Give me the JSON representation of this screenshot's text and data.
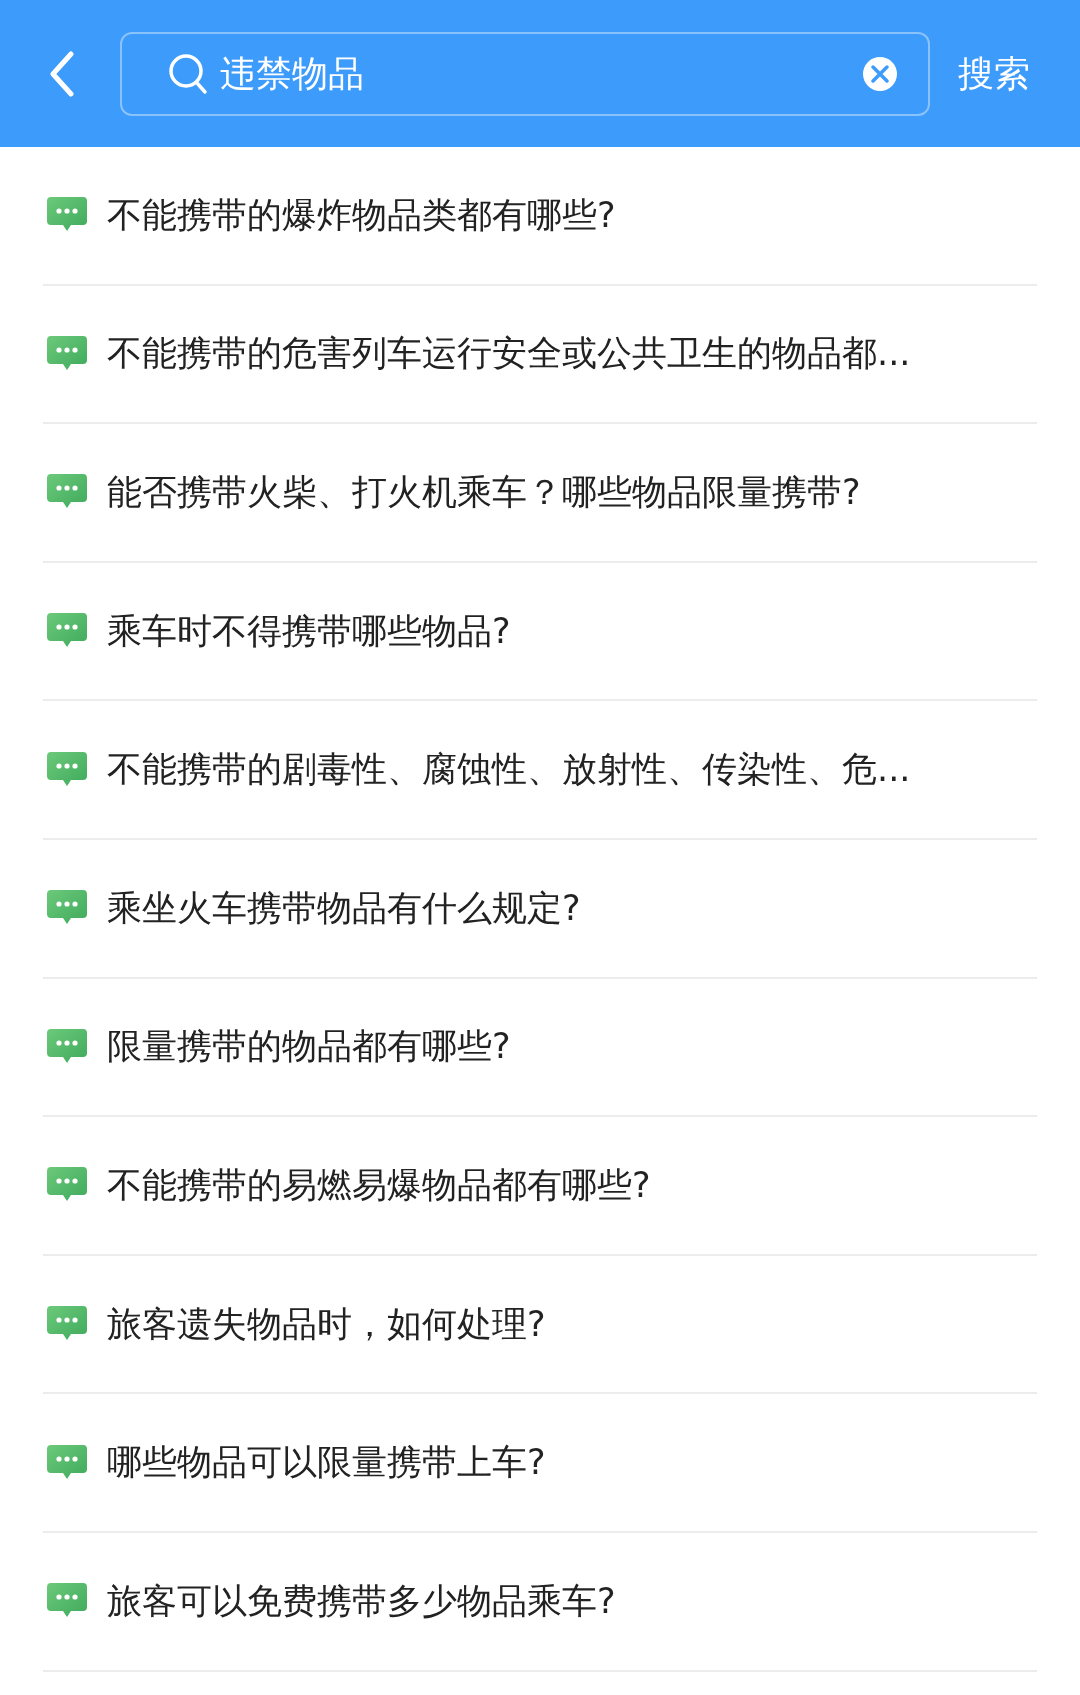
{
  "search": {
    "value": "违禁物品",
    "button": "搜索"
  },
  "results": [
    {
      "text": "不能携带的爆炸物品类都有哪些?"
    },
    {
      "text": "不能携带的危害列车运行安全或公共卫生的物品都..."
    },
    {
      "text": "能否携带火柴、打火机乘车？哪些物品限量携带?"
    },
    {
      "text": "乘车时不得携带哪些物品?"
    },
    {
      "text": "不能携带的剧毒性、腐蚀性、放射性、传染性、危..."
    },
    {
      "text": "乘坐火车携带物品有什么规定?"
    },
    {
      "text": "限量携带的物品都有哪些?"
    },
    {
      "text": "不能携带的易燃易爆物品都有哪些?"
    },
    {
      "text": "旅客遗失物品时，如何处理?"
    },
    {
      "text": "哪些物品可以限量携带上车?"
    },
    {
      "text": "旅客可以免费携带多少物品乘车?"
    }
  ]
}
